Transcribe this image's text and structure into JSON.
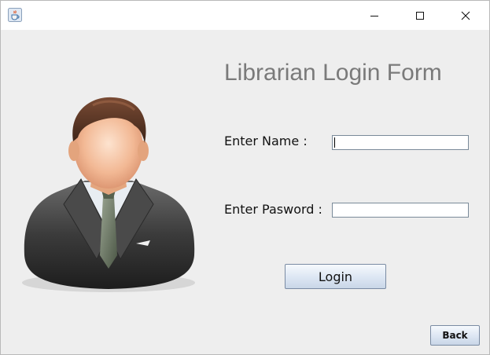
{
  "window": {
    "icons": {
      "app": "java-cup-icon",
      "minimize": "minimize-icon",
      "maximize": "maximize-icon",
      "close": "close-icon"
    }
  },
  "form": {
    "title": "Librarian Login Form",
    "name_label": "Enter Name :",
    "name_value": "",
    "password_label": "Enter Pasword :",
    "password_value": "",
    "login_label": "Login",
    "back_label": "Back"
  },
  "image": {
    "icon": "businessman-avatar-icon"
  },
  "colors": {
    "background": "#eeeeee",
    "title_text": "#7a7a7a",
    "button_top": "#f6f9fd",
    "button_bottom": "#c9d6e7",
    "button_border": "#7a8ba3"
  }
}
